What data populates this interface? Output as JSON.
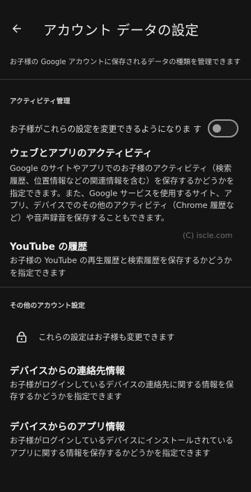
{
  "header": {
    "title": "アカウント データの設定"
  },
  "description": "お子様の Google アカウントに保存されるデータの種類を管理できます",
  "activity_section": {
    "header": "アクティビティ管理",
    "toggle": {
      "label": "お子様がこれらの設定を変更できるようになりま す",
      "state": "off"
    },
    "items": [
      {
        "title": "ウェブとアプリのアクティビティ",
        "lines": [
          "Google のサイトやアプリでのお子様のアクティビティ（検索",
          "履歴、位置情報などの関連情報を含む）を保存するかどうかを",
          "指定できます。また、Google サービスを使用するサイト、ア",
          "プリ、デバイスでのその他のアクティビティ（Chrome 履歴な",
          "ど）や音声録音を保存することもできます。"
        ]
      },
      {
        "title": "YouTube の履歴",
        "lines": [
          "お子様の YouTube の再生履歴と検索履歴を保存するかどうか",
          "を指定できます"
        ]
      }
    ]
  },
  "watermark": "(C) iscle.com",
  "other_section": {
    "header": "その他のアカウント設定",
    "lock_note": "これらの設定はお子様も変更できます",
    "items": [
      {
        "title": "デバイスからの連絡先情報",
        "lines": [
          "お子様がログインしているデバイスの連絡先に関する情報を保",
          "存するかどうかを指定できます"
        ]
      },
      {
        "title": "デバイスからのアプリ情報",
        "lines": [
          "お子様がログインしているデバイスにインストールされている",
          "アプリに関する情報を保存するかどうかを指定できます"
        ]
      }
    ]
  },
  "icons": {
    "back": "arrow-back-icon",
    "lock": "lock-icon"
  },
  "colors": {
    "background": "#141414",
    "text_primary": "#f0f0f0",
    "text_secondary": "#cfcfcf",
    "divider": "#3a3a3a"
  }
}
